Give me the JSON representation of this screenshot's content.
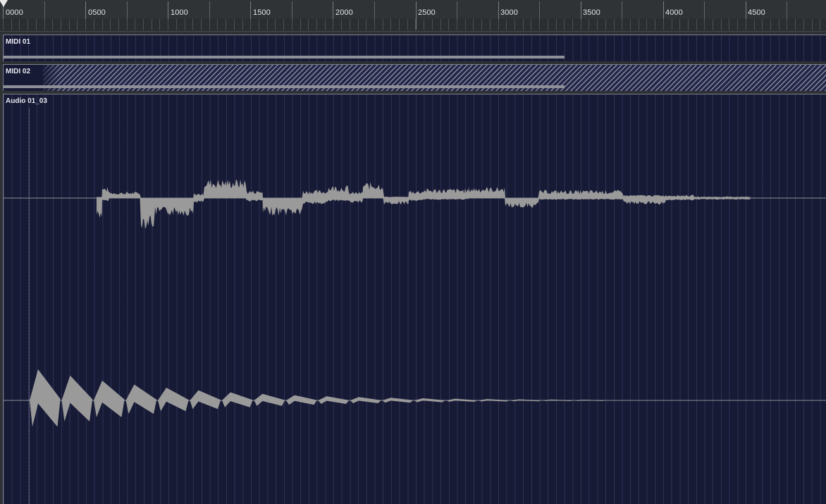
{
  "ruler": {
    "labels": [
      "0000",
      "0500",
      "1000",
      "1500",
      "2000",
      "2500",
      "3000",
      "3500",
      "4000",
      "4500"
    ]
  },
  "tracks": [
    {
      "name": "MIDI 01"
    },
    {
      "name": "MIDI 02"
    },
    {
      "name": "Audio 01_03"
    }
  ],
  "colors": {
    "lane_background": "#171a35",
    "waveform": "#9a9a9a",
    "ruler_background": "#2f3335"
  }
}
